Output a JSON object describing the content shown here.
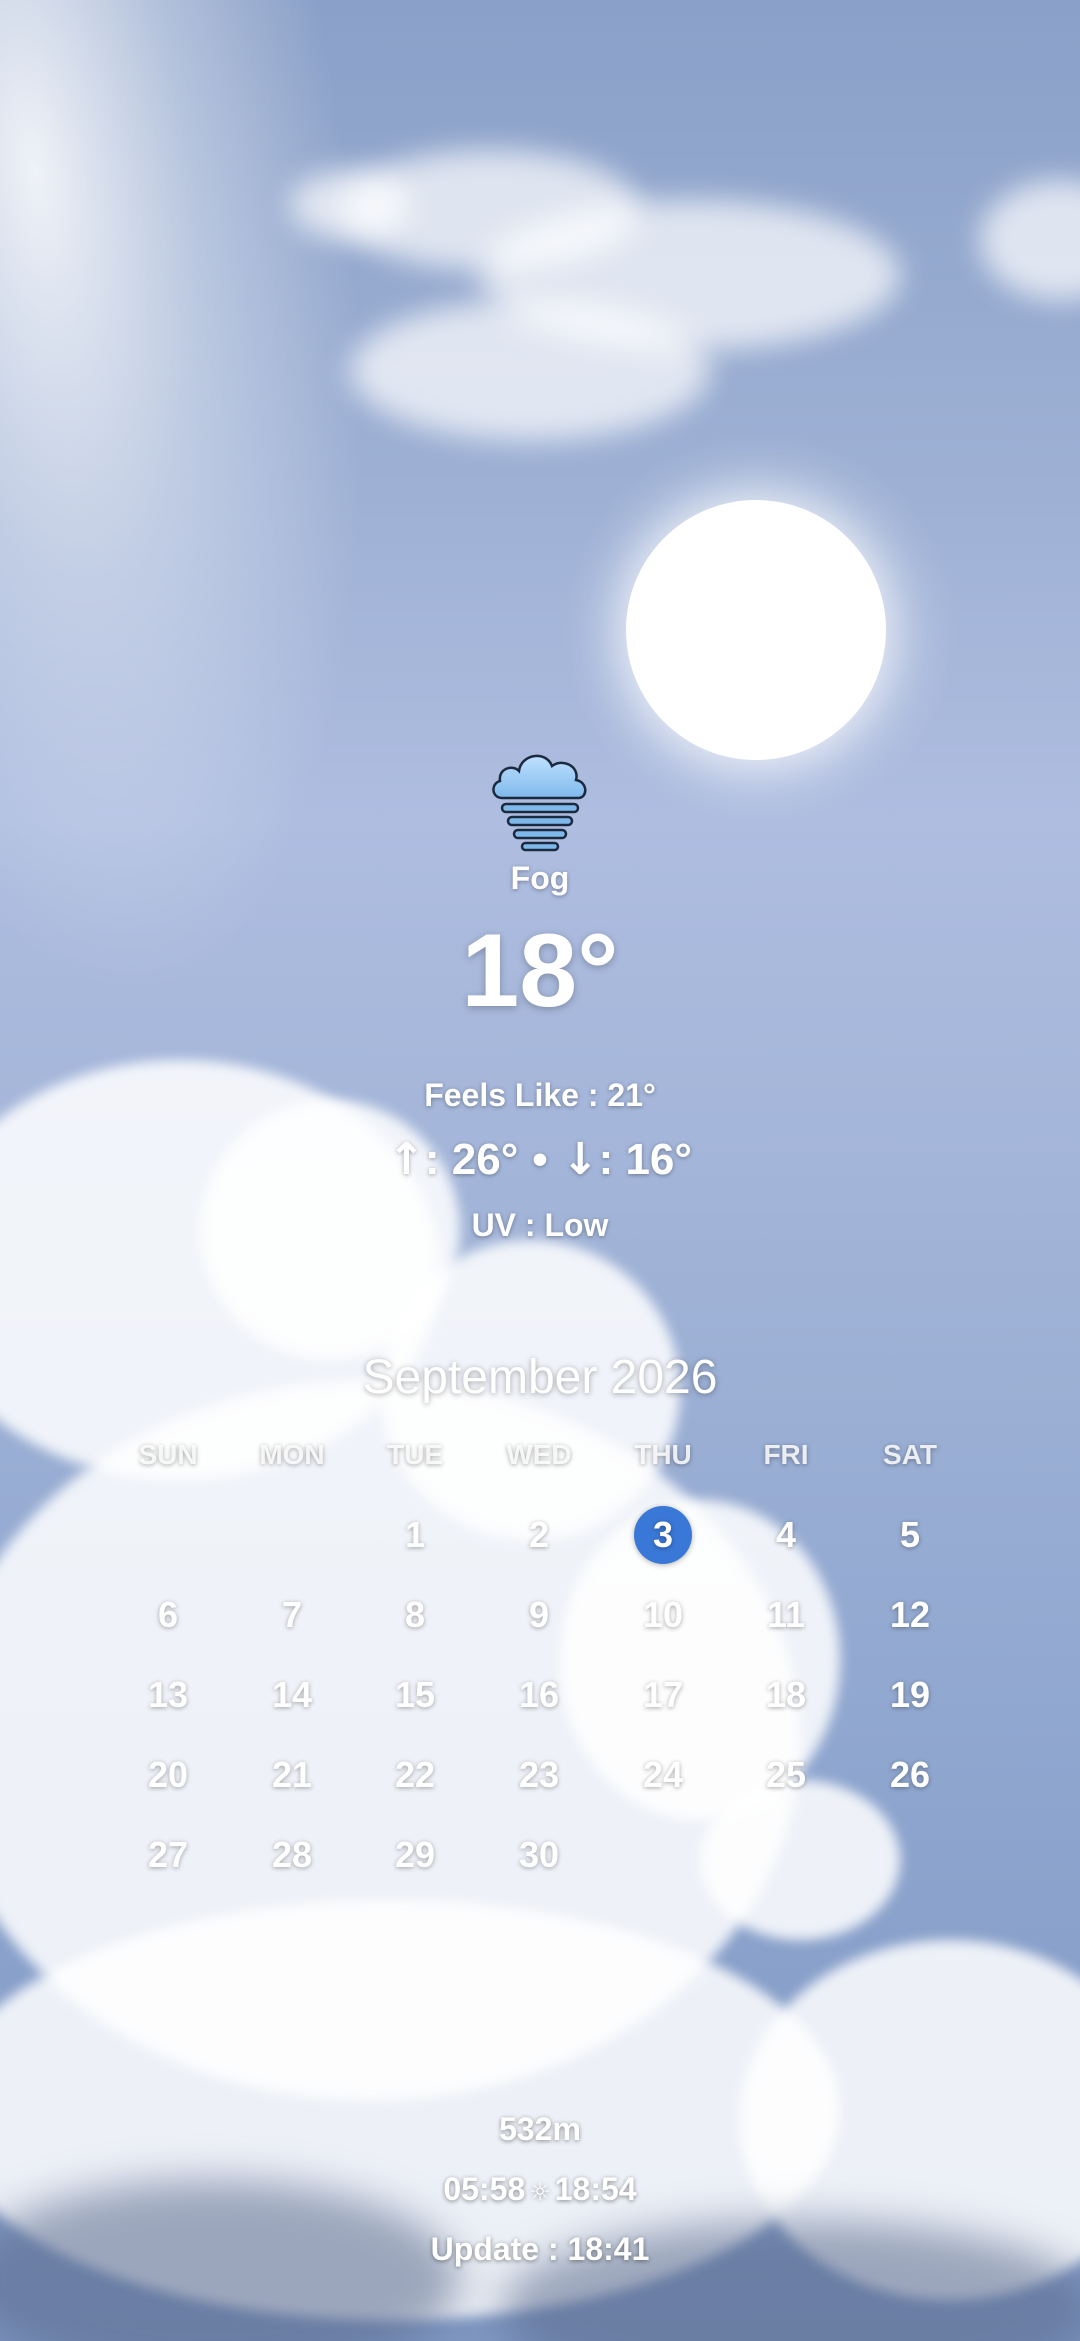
{
  "weather": {
    "icon": "fog-icon",
    "condition": "Fog",
    "temperature": "18°",
    "feels_like": "Feels Like : 21°",
    "high_arrow": "↑",
    "high": ": 26°",
    "separator": "•",
    "low_arrow": "↓",
    "low": ": 16°",
    "uv": "UV : Low"
  },
  "calendar": {
    "title": "September 2026",
    "weekdays": [
      "SUN",
      "MON",
      "TUE",
      "WED",
      "THU",
      "FRI",
      "SAT"
    ],
    "weeks": [
      [
        "",
        "",
        "1",
        "2",
        "3",
        "4",
        "5"
      ],
      [
        "6",
        "7",
        "8",
        "9",
        "10",
        "11",
        "12"
      ],
      [
        "13",
        "14",
        "15",
        "16",
        "17",
        "18",
        "19"
      ],
      [
        "20",
        "21",
        "22",
        "23",
        "24",
        "25",
        "26"
      ],
      [
        "27",
        "28",
        "29",
        "30",
        "",
        "",
        ""
      ]
    ],
    "today": "3",
    "today_color": "#3a78d8"
  },
  "footer": {
    "altitude": "532m",
    "sunrise": "05:58",
    "sun_icon": "☼",
    "sunset": "18:54",
    "update": "Update : 18:41"
  }
}
